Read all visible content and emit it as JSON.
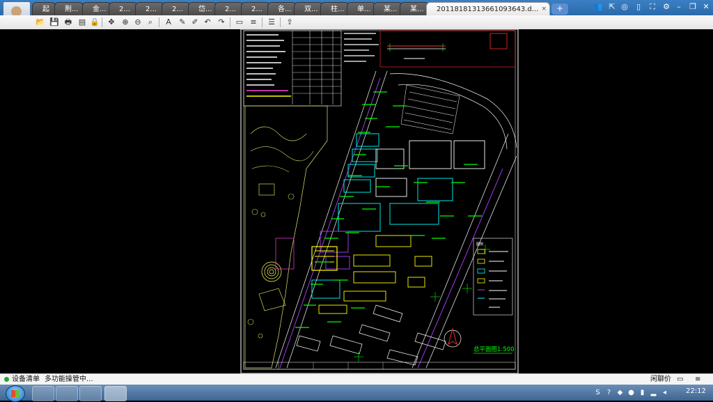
{
  "tabs": [
    {
      "label": "起"
    },
    {
      "label": "荆..."
    },
    {
      "label": "金..."
    },
    {
      "label": "2..."
    },
    {
      "label": "2..."
    },
    {
      "label": "2..."
    },
    {
      "label": "岱..."
    },
    {
      "label": "2..."
    },
    {
      "label": "2..."
    },
    {
      "label": "各..."
    },
    {
      "label": "双..."
    },
    {
      "label": "柱..."
    },
    {
      "label": "单..."
    },
    {
      "label": "某..."
    }
  ],
  "active_tab": {
    "label": "20118181313661093643.d...",
    "close": "×"
  },
  "new_tab": "+",
  "drawing": {
    "plan_title": "总平面图1:500",
    "legend_title": "图例"
  },
  "statusbar": {
    "item1": "设备清单",
    "item2": "多功能操管中...",
    "tray_label": "闲聊价"
  },
  "taskbar": {
    "clock": "22:12"
  },
  "colors": {
    "tabbar": "#2a6aa9",
    "cad_bg": "#000000",
    "cad_green": "#00ff00",
    "cad_cyan": "#00ffff",
    "cad_yellow": "#ffff00"
  }
}
